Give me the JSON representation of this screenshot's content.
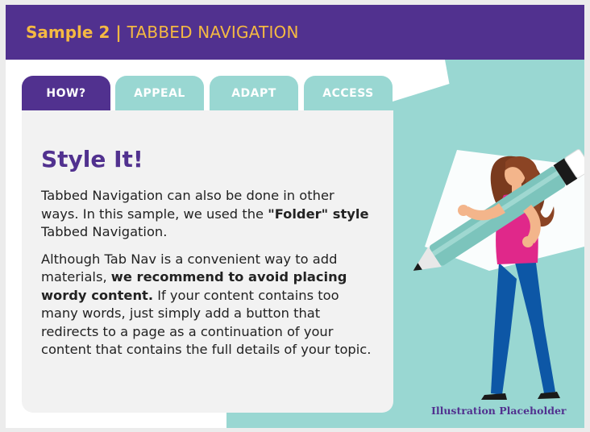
{
  "header": {
    "sample_label": "Sample 2",
    "separator": "|",
    "title": "TABBED NAVIGATION"
  },
  "tabs": [
    {
      "label": "HOW?",
      "active": true
    },
    {
      "label": "APPEAL",
      "active": false
    },
    {
      "label": "ADAPT",
      "active": false
    },
    {
      "label": "ACCESS",
      "active": false
    }
  ],
  "content": {
    "heading": "Style It!",
    "p1_a": "Tabbed Navigation can also be done in other ways. In this sample, we used the ",
    "p1_b": "\"Folder\" style",
    "p1_c": " Tabbed Navigation.",
    "p2_a": "Although Tab Nav is a convenient way to add materials, ",
    "p2_b": "we recommend to avoid placing wordy content.",
    "p2_c": " If your content contains too many words, just simply add a button that redirects to a page as a continuation of your content that contains the full details of your topic."
  },
  "illustration": {
    "caption": "Illustration Placeholder"
  },
  "colors": {
    "purple": "#51318f",
    "gold": "#f5b942",
    "teal": "#99d7d2",
    "panel": "#f2f2f2"
  }
}
